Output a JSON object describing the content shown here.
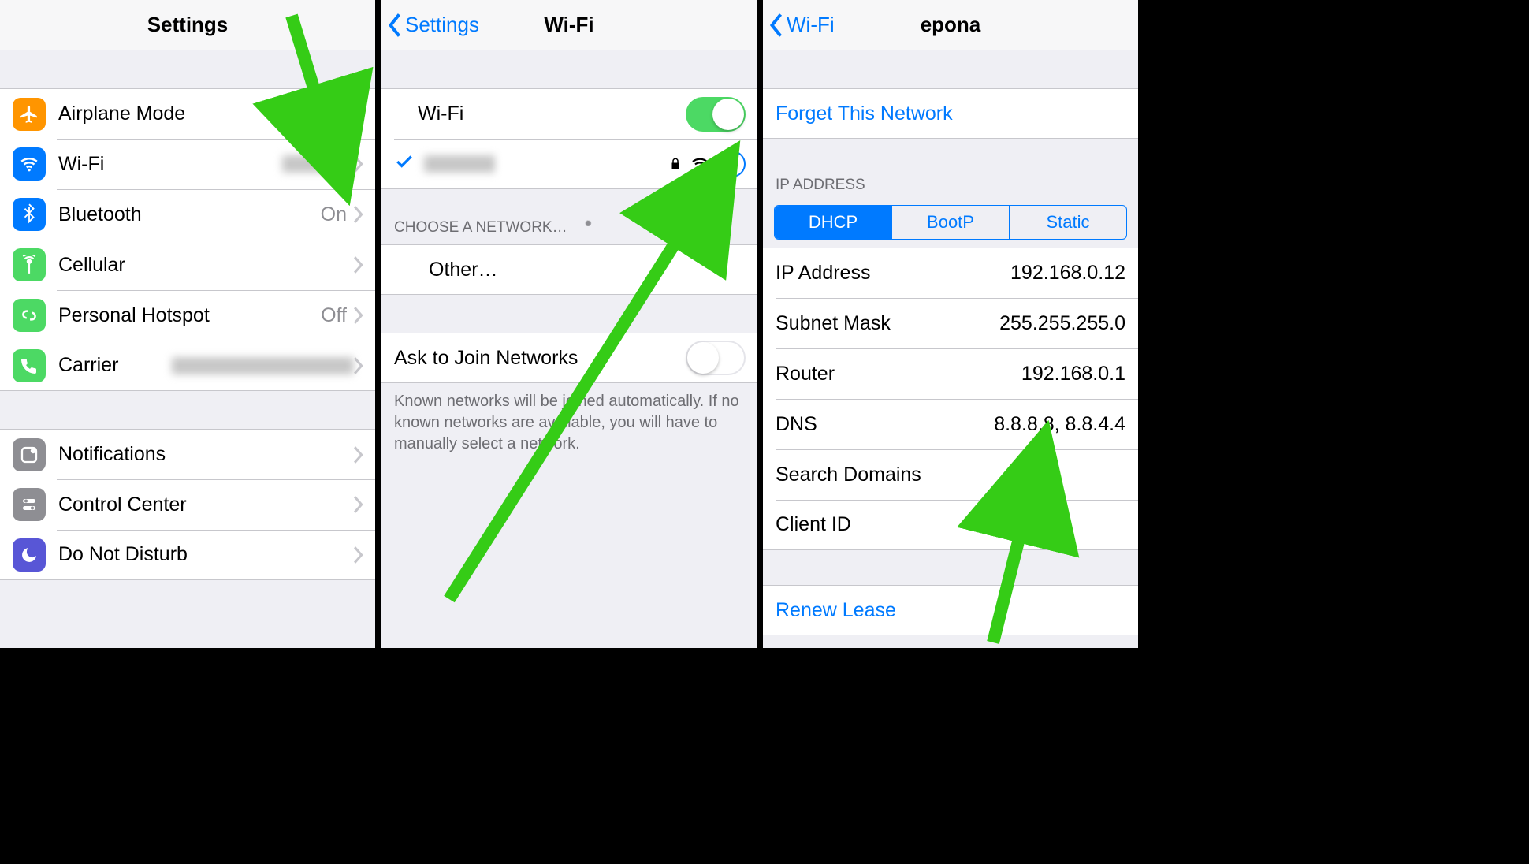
{
  "colors": {
    "accent": "#007aff",
    "green": "#4cd964",
    "arrow": "#35cc16"
  },
  "panel1": {
    "title": "Settings",
    "rows": [
      {
        "icon": "airplane",
        "icon_bg": "#ff9500",
        "label": "Airplane Mode",
        "type": "toggle",
        "toggle_on": false
      },
      {
        "icon": "wifi",
        "icon_bg": "#007aff",
        "label": "Wi-Fi",
        "value_redacted": true,
        "type": "disclosure"
      },
      {
        "icon": "bluetooth",
        "icon_bg": "#007aff",
        "label": "Bluetooth",
        "value": "On",
        "type": "disclosure"
      },
      {
        "icon": "cellular",
        "icon_bg": "#4cd964",
        "label": "Cellular",
        "type": "disclosure"
      },
      {
        "icon": "hotspot",
        "icon_bg": "#4cd964",
        "label": "Personal Hotspot",
        "value": "Off",
        "type": "disclosure"
      },
      {
        "icon": "carrier",
        "icon_bg": "#4cd964",
        "label": "Carrier",
        "value_redacted_long": true,
        "type": "disclosure"
      }
    ],
    "rows2": [
      {
        "icon": "notifications",
        "icon_bg": "#8e8e93",
        "label": "Notifications",
        "type": "disclosure"
      },
      {
        "icon": "controlcenter",
        "icon_bg": "#8e8e93",
        "label": "Control Center",
        "type": "disclosure"
      },
      {
        "icon": "dnd",
        "icon_bg": "#5856d6",
        "label": "Do Not Disturb",
        "type": "disclosure"
      }
    ]
  },
  "panel2": {
    "back": "Settings",
    "title": "Wi-Fi",
    "wifi_label": "Wi-Fi",
    "wifi_on": true,
    "connected_redacted": true,
    "choose_header": "CHOOSE A NETWORK…",
    "other_label": "Other…",
    "ask_label": "Ask to Join Networks",
    "ask_on": false,
    "footer": "Known networks will be joined automatically. If no known networks are available, you will have to manually select a network."
  },
  "panel3": {
    "back": "Wi-Fi",
    "title": "epona",
    "forget": "Forget This Network",
    "ip_header": "IP ADDRESS",
    "segments": [
      "DHCP",
      "BootP",
      "Static"
    ],
    "segment_active": 0,
    "details": [
      {
        "label": "IP Address",
        "value": "192.168.0.12"
      },
      {
        "label": "Subnet Mask",
        "value": "255.255.255.0"
      },
      {
        "label": "Router",
        "value": "192.168.0.1"
      },
      {
        "label": "DNS",
        "value": "8.8.8.8, 8.8.4.4"
      },
      {
        "label": "Search Domains",
        "value": ""
      },
      {
        "label": "Client ID",
        "value": ""
      }
    ],
    "renew": "Renew Lease"
  }
}
